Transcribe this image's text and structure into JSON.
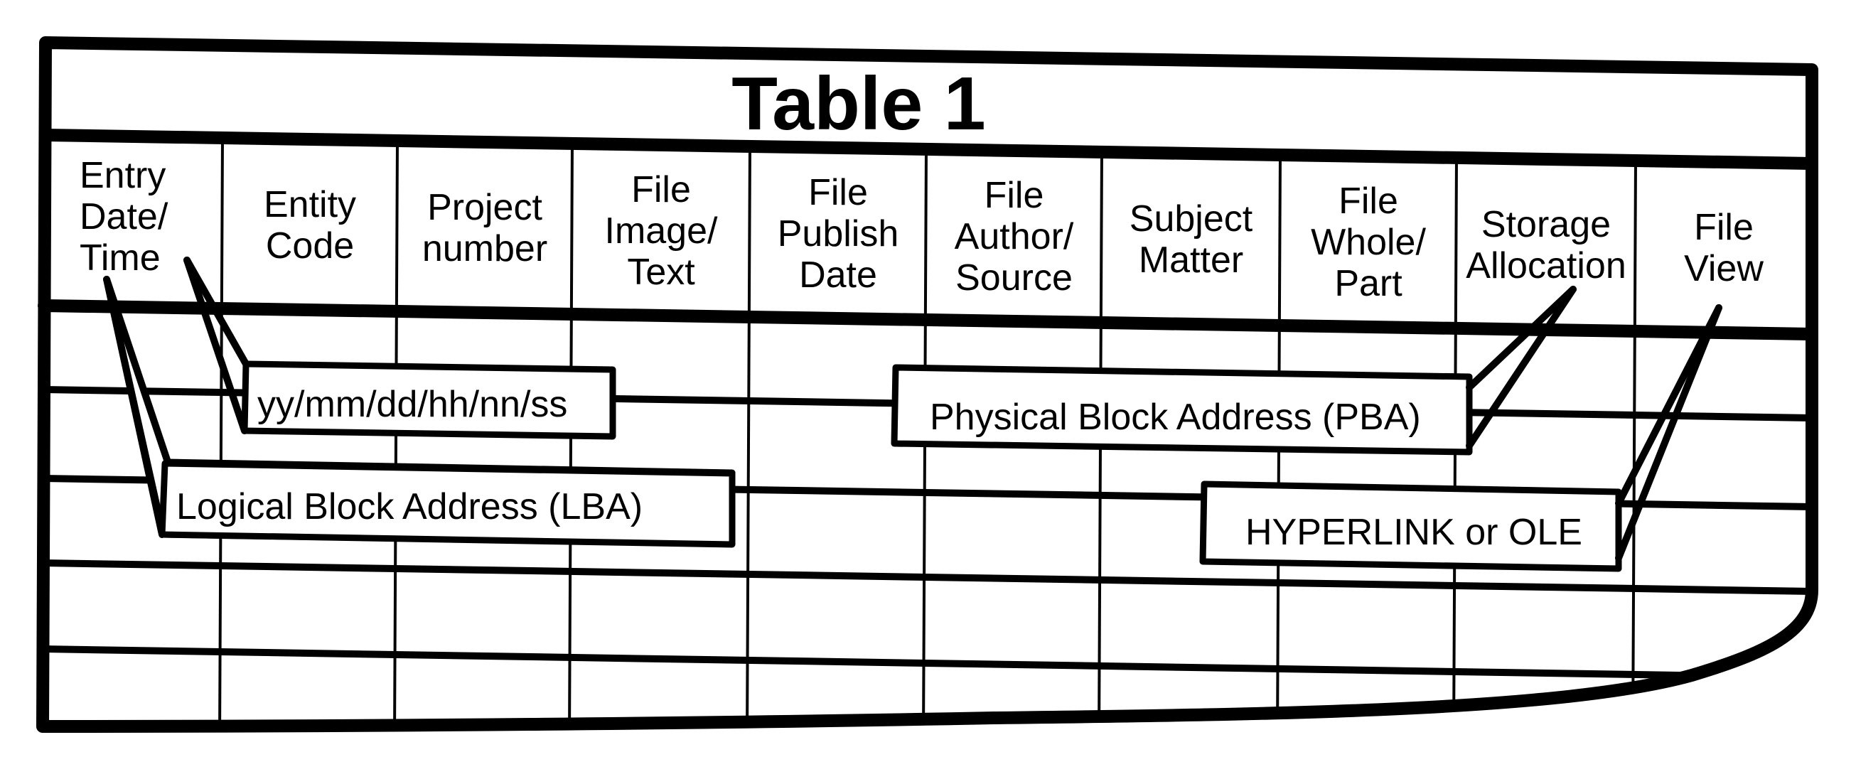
{
  "table": {
    "title": "Table 1",
    "columns": [
      {
        "key": "entry_date_time",
        "lines": [
          "Entry",
          "Date/",
          "Time"
        ]
      },
      {
        "key": "entity_code",
        "lines": [
          "Entity",
          "Code"
        ]
      },
      {
        "key": "project_number",
        "lines": [
          "Project",
          "number"
        ]
      },
      {
        "key": "file_image_text",
        "lines": [
          "File",
          "Image/",
          "Text"
        ]
      },
      {
        "key": "file_publish_date",
        "lines": [
          "File",
          "Publish",
          "Date"
        ]
      },
      {
        "key": "file_author_source",
        "lines": [
          "File",
          "Author/",
          "Source"
        ]
      },
      {
        "key": "subject_matter",
        "lines": [
          "Subject",
          "Matter"
        ]
      },
      {
        "key": "file_whole_part",
        "lines": [
          "File",
          "Whole/",
          "Part"
        ]
      },
      {
        "key": "storage_allocation",
        "lines": [
          "Storage",
          "Allocation"
        ]
      },
      {
        "key": "file_view",
        "lines": [
          "File",
          "View"
        ]
      }
    ],
    "empty_row_count": 5
  },
  "callouts": [
    {
      "id": "date-format",
      "text": "yy/mm/dd/hh/nn/ss",
      "points_to": "entry_date_time"
    },
    {
      "id": "lba",
      "text": "Logical Block Address (LBA)",
      "points_to": "entry_date_time"
    },
    {
      "id": "pba",
      "text": "Physical Block Address (PBA)",
      "points_to": "storage_allocation"
    },
    {
      "id": "hyperlink",
      "text": "HYPERLINK or OLE",
      "points_to": "file_view"
    }
  ],
  "colors": {
    "ink": "#000000",
    "paper": "#ffffff"
  }
}
